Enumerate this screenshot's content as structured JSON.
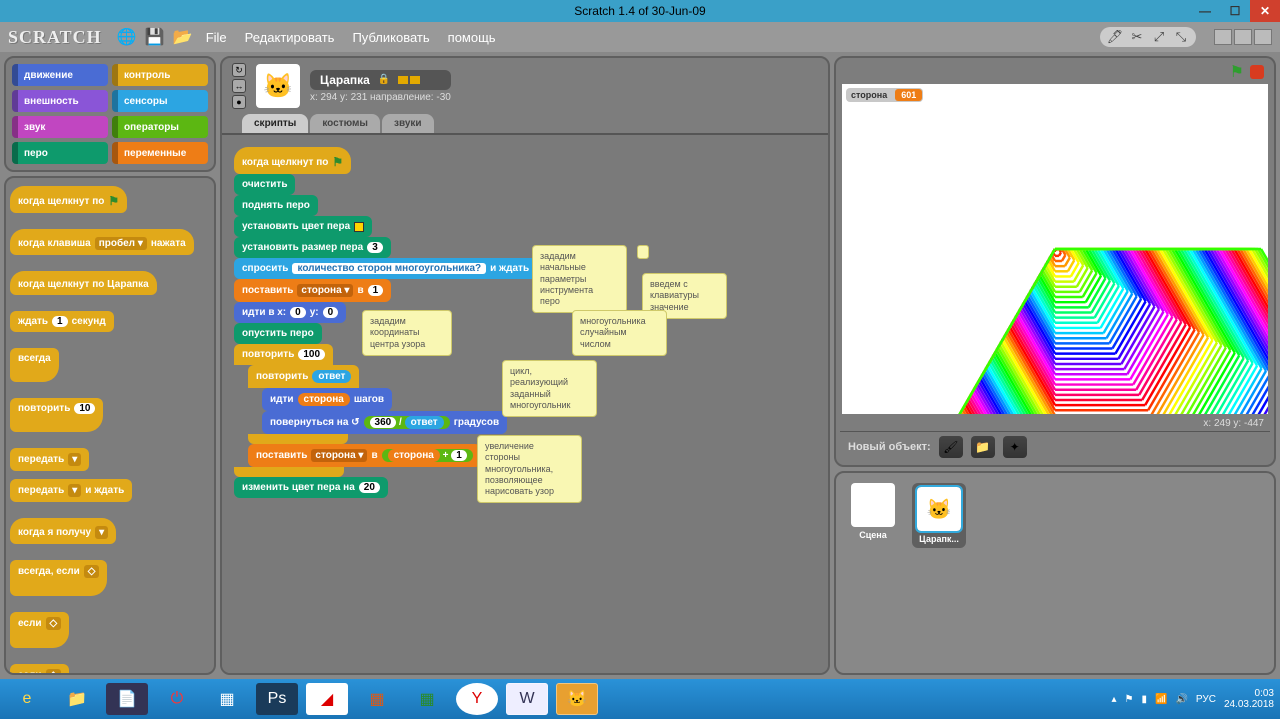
{
  "titlebar": {
    "title": "Scratch 1.4 of 30-Jun-09"
  },
  "menu": {
    "file": "File",
    "edit": "Редактировать",
    "share": "Публиковать",
    "help": "помощь"
  },
  "categories": {
    "motion": "движение",
    "control": "контроль",
    "looks": "внешность",
    "sensing": "сенсоры",
    "sound": "звук",
    "operators": "операторы",
    "pen": "перо",
    "variables": "переменные"
  },
  "palette": {
    "when_flag": "когда щелкнут по",
    "when_key": "когда клавиша",
    "when_key_key": "пробел ▾",
    "when_key_pressed": "нажата",
    "when_sprite": "когда щелкнут по  Царапка",
    "wait": "ждать",
    "wait_arg": "1",
    "wait_sec": "секунд",
    "forever": "всегда",
    "repeat": "повторить",
    "repeat_arg": "10",
    "broadcast": "передать",
    "broadcast_dd": "▾",
    "broadcast_wait": "передать",
    "broadcast_wait_dd": "▾",
    "broadcast_wait_tail": "и ждать",
    "when_receive": "когда я получу",
    "when_receive_dd": "▾",
    "forever_if": "всегда, если",
    "if": "если",
    "if2": "если"
  },
  "sprite_header": {
    "name": "Царапка",
    "coords": "x: 294   y: 231   направление: -30"
  },
  "tabs": {
    "scripts": "скрипты",
    "costumes": "костюмы",
    "sounds": "звуки"
  },
  "script": {
    "when_flag": "когда щелкнут по",
    "clear": "очистить",
    "pen_up": "поднять перо",
    "set_pen_color": "установить цвет пера",
    "set_pen_size": "установить размер пера",
    "pen_size_arg": "3",
    "ask": "спросить",
    "ask_q": "количество сторон многоугольника?",
    "ask_wait": "и ждать",
    "set_var": "поставить",
    "var_name": "сторона ▾",
    "set_var_to": " в ",
    "set_var_val": "1",
    "goto": "идти в x:",
    "goto_x": "0",
    "goto_y_lbl": "y:",
    "goto_y": "0",
    "pen_down": "опустить перо",
    "repeat1": "повторить",
    "repeat1_arg": "100",
    "repeat2": "повторить",
    "repeat2_arg": "ответ",
    "move": "идти",
    "move_var": "сторона",
    "move_steps": "шагов",
    "turn": "повернуться на ↺",
    "turn_a": "360",
    "turn_div": "/",
    "turn_b": "ответ",
    "turn_deg": "градусов",
    "set_var2": "поставить",
    "var_name2": "сторона ▾",
    "set_var2_to": " в ",
    "op_plus_a": "сторона",
    "op_plus": "+",
    "op_plus_b": "1",
    "change_pen": "изменить цвет пера на",
    "change_pen_arg": "20"
  },
  "comments": {
    "c1": "зададим\nначальные\nпараметры\nинструмента\nперо",
    "c2": "введем с\nклавиатуры\nзначение",
    "c3": "многоугольника\nслучайным\nчислом",
    "c4": "зададим\nкоординаты\nцентра узора",
    "c5": "цикл,\nреализующий\nзаданный\nмногоугольник",
    "c6": "увеличение\nстороны\nмногоугольника,\nпозволяющее\nнарисовать узор"
  },
  "stage": {
    "watcher_label": "сторона",
    "watcher_value": "601",
    "mouse_coords": "x: 249   y: -447",
    "new_object": "Новый объект:",
    "sprite1": "Царапк...",
    "scene": "Сцена"
  },
  "taskbar": {
    "lang": "РУС",
    "time": "0:03",
    "date": "24.03.2018"
  }
}
